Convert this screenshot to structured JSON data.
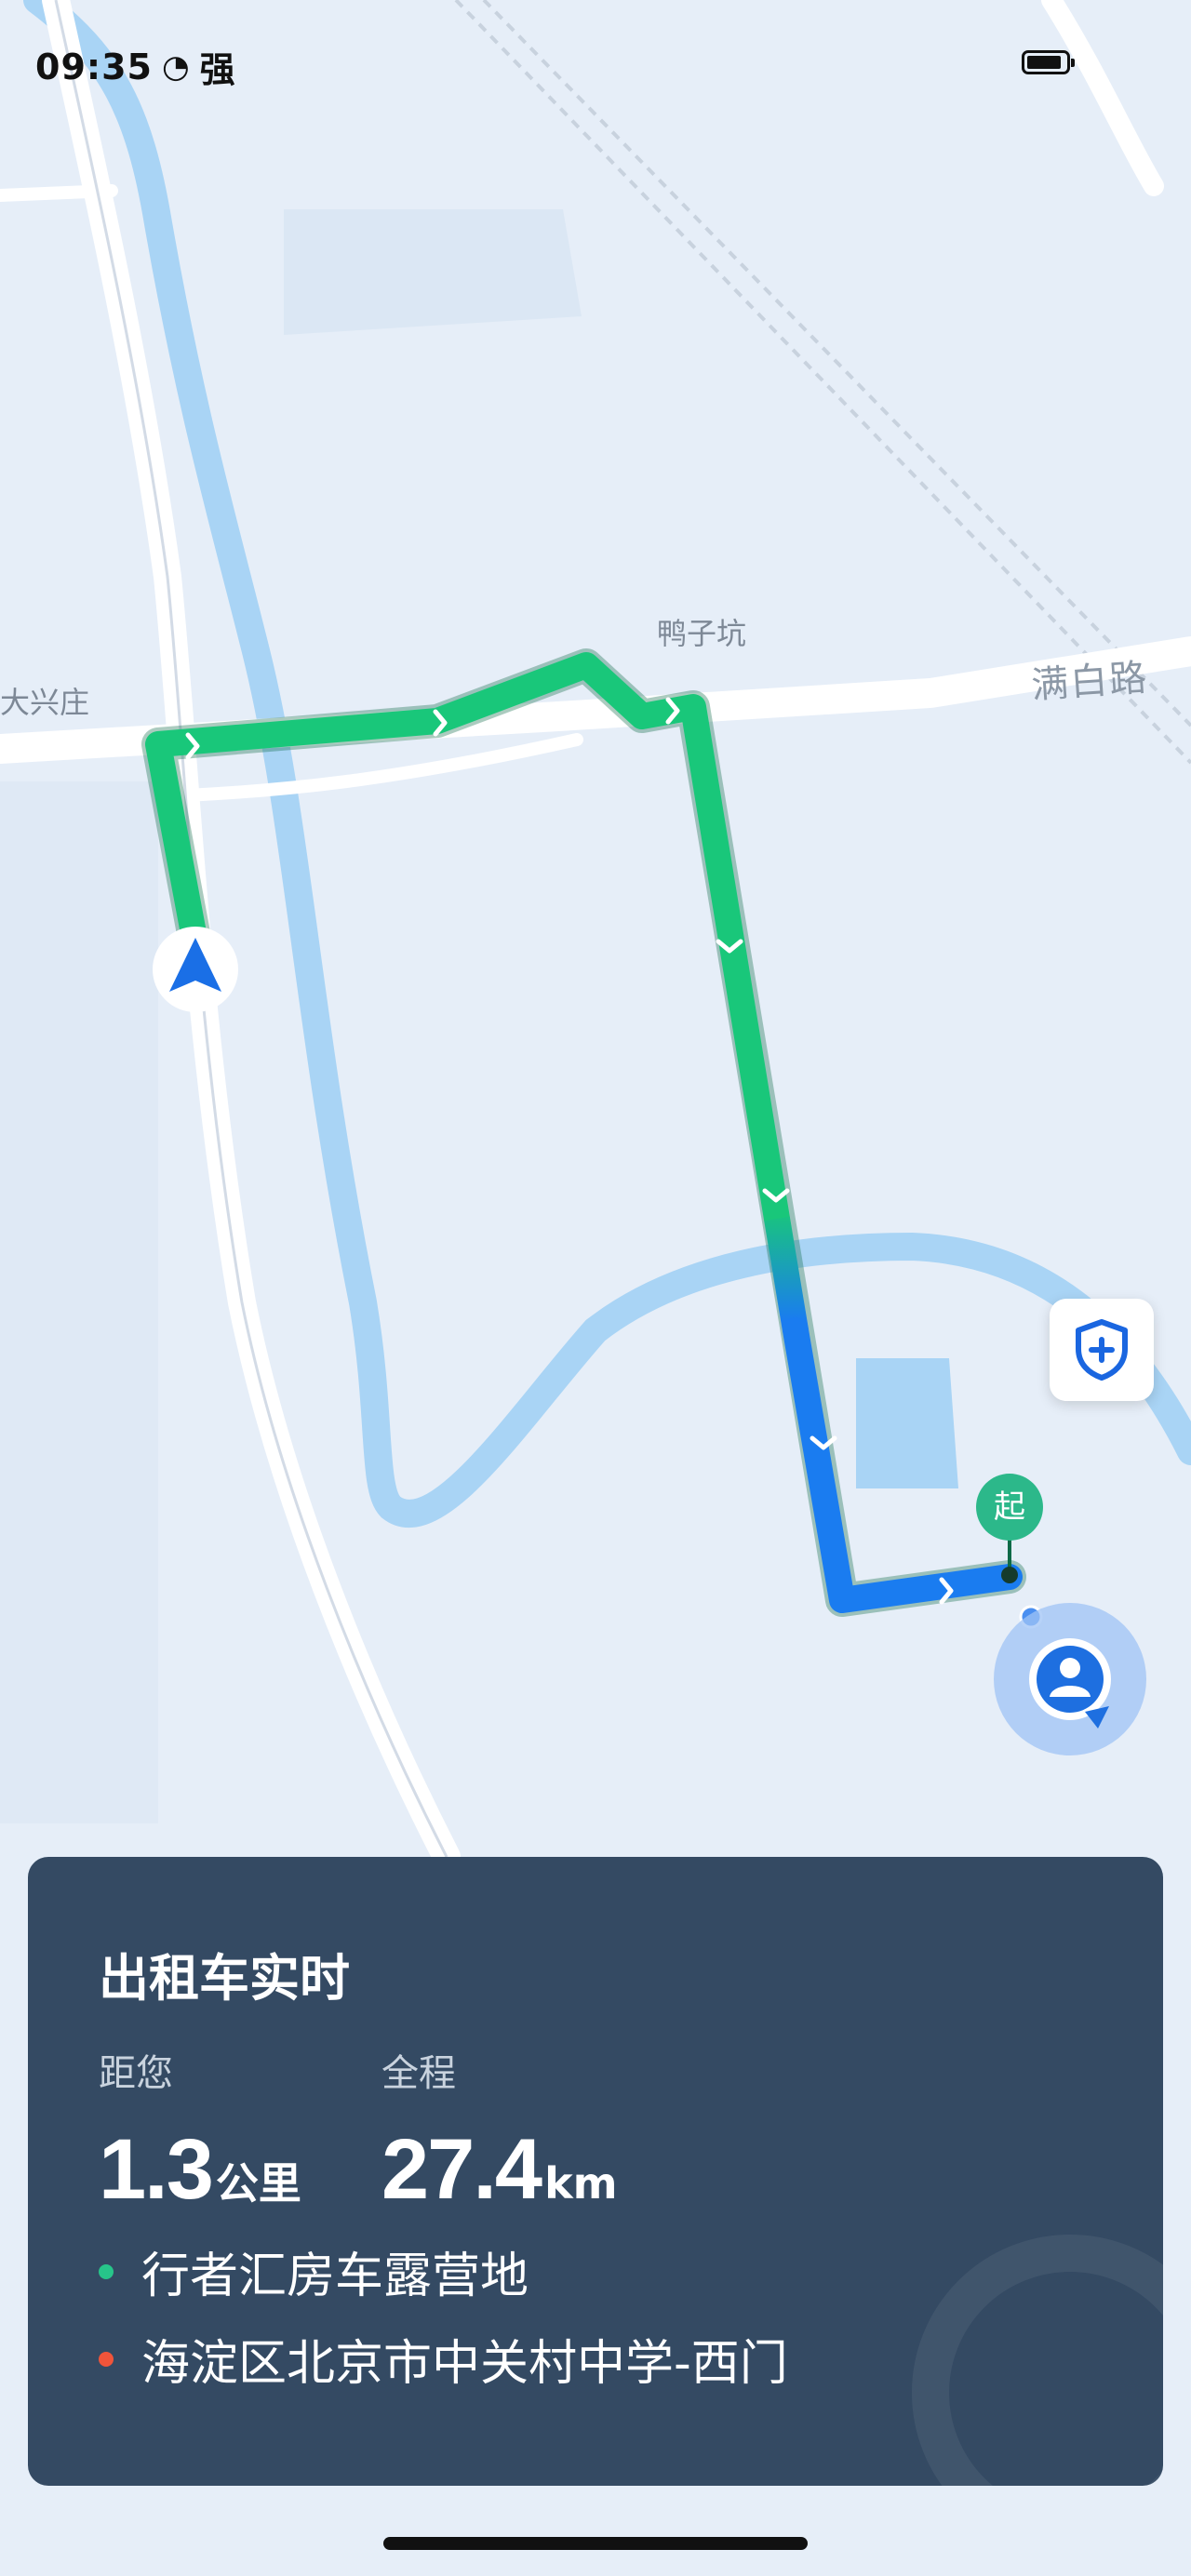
{
  "status_bar": {
    "time": "09:35",
    "signal_icon": "signal-icon",
    "signal_text": "强",
    "battery_icon": "battery-icon"
  },
  "map": {
    "labels": {
      "village_top": "鸭子坑",
      "village_left": "大兴庄",
      "road_right": "满白路"
    },
    "start_marker": "起",
    "route_colors": {
      "green": "#19c77a",
      "blue": "#1a7cf0",
      "water": "#a9d4f5"
    }
  },
  "panel": {
    "title": "出租车实时",
    "distance_label": "距您",
    "distance_value": "1.3",
    "distance_unit": "公里",
    "total_label": "全程",
    "total_value": "27.4",
    "total_unit": "km",
    "origin": "行者汇房车露营地",
    "destination": "海淀区北京市中关村中学-西门",
    "origin_color": "#27c58a",
    "destination_color": "#f0543a"
  }
}
